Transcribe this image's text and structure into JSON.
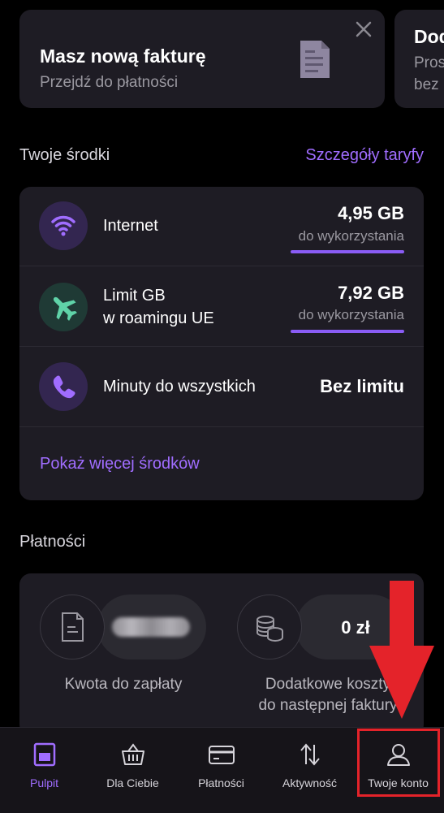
{
  "invoice_card": {
    "title": "Masz nową fakturę",
    "subtitle": "Przejdź do płatności",
    "icon": "document-icon",
    "close_icon": "close-icon"
  },
  "second_card": {
    "title": "Dod",
    "subtitle_line1": "Pros",
    "subtitle_line2": "bez"
  },
  "resources": {
    "section_title": "Twoje środki",
    "details_link": "Szczegóły taryfy",
    "items": [
      {
        "icon": "wifi-icon",
        "label_line1": "Internet",
        "label_line2": "",
        "value": "4,95 GB",
        "note": "do wykorzystania",
        "remaining_fraction": 1.0
      },
      {
        "icon": "airplane-icon",
        "label_line1": "Limit GB",
        "label_line2": "w roamingu UE",
        "value": "7,92 GB",
        "note": "do wykorzystania",
        "remaining_fraction": 1.0
      },
      {
        "icon": "phone-icon",
        "label_line1": "Minuty do wszystkich",
        "label_line2": "",
        "value": "Bez limitu",
        "note": ""
      }
    ],
    "more_link": "Pokaż więcej środków"
  },
  "payments": {
    "section_title": "Płatności",
    "amount_due_label": "Kwota do zapłaty",
    "amount_due_value_hidden": true,
    "extra_costs_value": "0 zł",
    "extra_costs_label_line1": "Dodatkowe koszty",
    "extra_costs_label_line2": "do następnej faktury"
  },
  "nav": {
    "items": [
      {
        "label": "Pulpit",
        "icon": "dashboard-icon",
        "active": true
      },
      {
        "label": "Dla Ciebie",
        "icon": "basket-icon",
        "active": false
      },
      {
        "label": "Płatności",
        "icon": "card-icon",
        "active": false
      },
      {
        "label": "Aktywność",
        "icon": "arrows-updown-icon",
        "active": false
      },
      {
        "label": "Twoje konto",
        "icon": "user-icon",
        "active": false
      }
    ]
  },
  "colors": {
    "accent": "#a06dff",
    "card_bg": "#1e1c24",
    "highlight": "#e4232a"
  }
}
